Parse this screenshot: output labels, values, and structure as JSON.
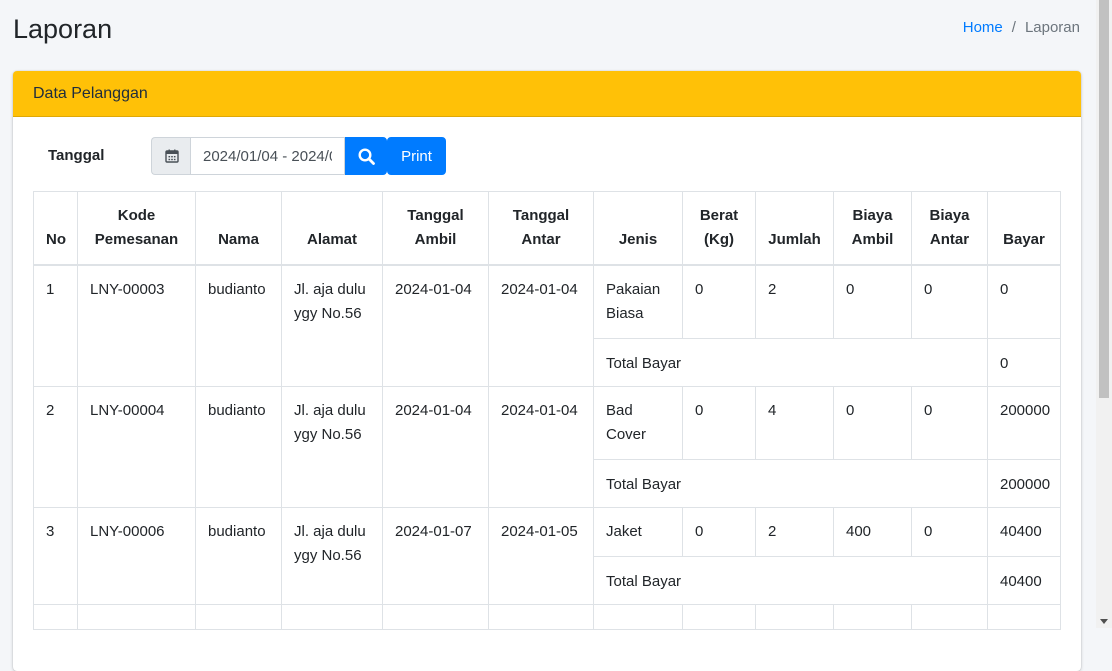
{
  "page": {
    "title": "Laporan"
  },
  "breadcrumb": {
    "home": "Home",
    "separator": "/",
    "current": "Laporan"
  },
  "card": {
    "header": "Data Pelanggan"
  },
  "filter": {
    "label": "Tanggal",
    "date_range_value": "2024/01/04 - 2024/0",
    "print_label": "Print"
  },
  "table": {
    "headers": {
      "no": "No",
      "kode_line1": "Kode",
      "kode_line2": "Pemesanan",
      "nama": "Nama",
      "alamat": "Alamat",
      "ambil_line1": "Tanggal",
      "ambil_line2": "Ambil",
      "antar_line1": "Tanggal",
      "antar_line2": "Antar",
      "jenis": "Jenis",
      "berat_line1": "Berat",
      "berat_line2": "(Kg)",
      "jumlah": "Jumlah",
      "biaya_ambil_line1": "Biaya",
      "biaya_ambil_line2": "Ambil",
      "biaya_antar_line1": "Biaya",
      "biaya_antar_line2": "Antar",
      "bayar": "Bayar"
    },
    "total_label": "Total Bayar",
    "rows": [
      {
        "no": "1",
        "kode": "LNY-00003",
        "nama": "budianto",
        "alamat_line1": "Jl. aja dulu",
        "alamat_line2": "ygy No.56",
        "tgl_ambil": "2024-01-04",
        "tgl_antar": "2024-01-04",
        "jenis_line1": "Pakaian",
        "jenis_line2": "Biasa",
        "berat": "0",
        "jumlah": "2",
        "biaya_ambil": "0",
        "biaya_antar": "0",
        "bayar": "0",
        "total": "0"
      },
      {
        "no": "2",
        "kode": "LNY-00004",
        "nama": "budianto",
        "alamat_line1": "Jl. aja dulu",
        "alamat_line2": "ygy No.56",
        "tgl_ambil": "2024-01-04",
        "tgl_antar": "2024-01-04",
        "jenis_line1": "Bad",
        "jenis_line2": "Cover",
        "berat": "0",
        "jumlah": "4",
        "biaya_ambil": "0",
        "biaya_antar": "0",
        "bayar": "200000",
        "total": "200000"
      },
      {
        "no": "3",
        "kode": "LNY-00006",
        "nama": "budianto",
        "alamat_line1": "Jl. aja dulu",
        "alamat_line2": "ygy No.56",
        "tgl_ambil": "2024-01-07",
        "tgl_antar": "2024-01-05",
        "jenis_line1": "Jaket",
        "jenis_line2": "",
        "berat": "0",
        "jumlah": "2",
        "biaya_ambil": "400",
        "biaya_antar": "0",
        "bayar": "40400",
        "total": "40400"
      }
    ]
  },
  "icons": {
    "calendar": "calendar-icon",
    "search": "search-icon"
  },
  "colors": {
    "header_bg": "#ffc107",
    "primary": "#007bff",
    "page_bg": "#f4f6f9"
  }
}
